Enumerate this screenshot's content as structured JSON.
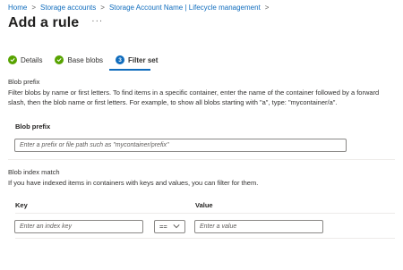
{
  "breadcrumb": {
    "items": [
      "Home",
      "Storage accounts",
      "Storage Account Name | Lifecycle management"
    ],
    "separator": ">"
  },
  "header": {
    "title": "Add a rule",
    "more": "···"
  },
  "steps": [
    {
      "label": "Details",
      "state": "done"
    },
    {
      "label": "Base blobs",
      "state": "done"
    },
    {
      "label": "Filter set",
      "state": "current",
      "number": "3"
    }
  ],
  "blob_prefix": {
    "section_title": "Blob prefix",
    "description": "Filter blobs by name or first letters. To find items in a specific container, enter the name of the container followed by a forward slash, then the blob name or first letters. For example, to show all blobs starting with \"a\", type: \"mycontainer/a\".",
    "field_label": "Blob prefix",
    "placeholder": "Enter a prefix or file path such as \"mycontainer/prefix\""
  },
  "blob_index": {
    "section_title": "Blob index match",
    "description": "If you have indexed items in containers with keys and values, you can filter for them.",
    "key_label": "Key",
    "value_label": "Value",
    "key_placeholder": "Enter an index key",
    "operator": "==",
    "value_placeholder": "Enter a value"
  },
  "colors": {
    "accent": "#0f6cbd",
    "success": "#57a300",
    "border": "#8a8886"
  }
}
